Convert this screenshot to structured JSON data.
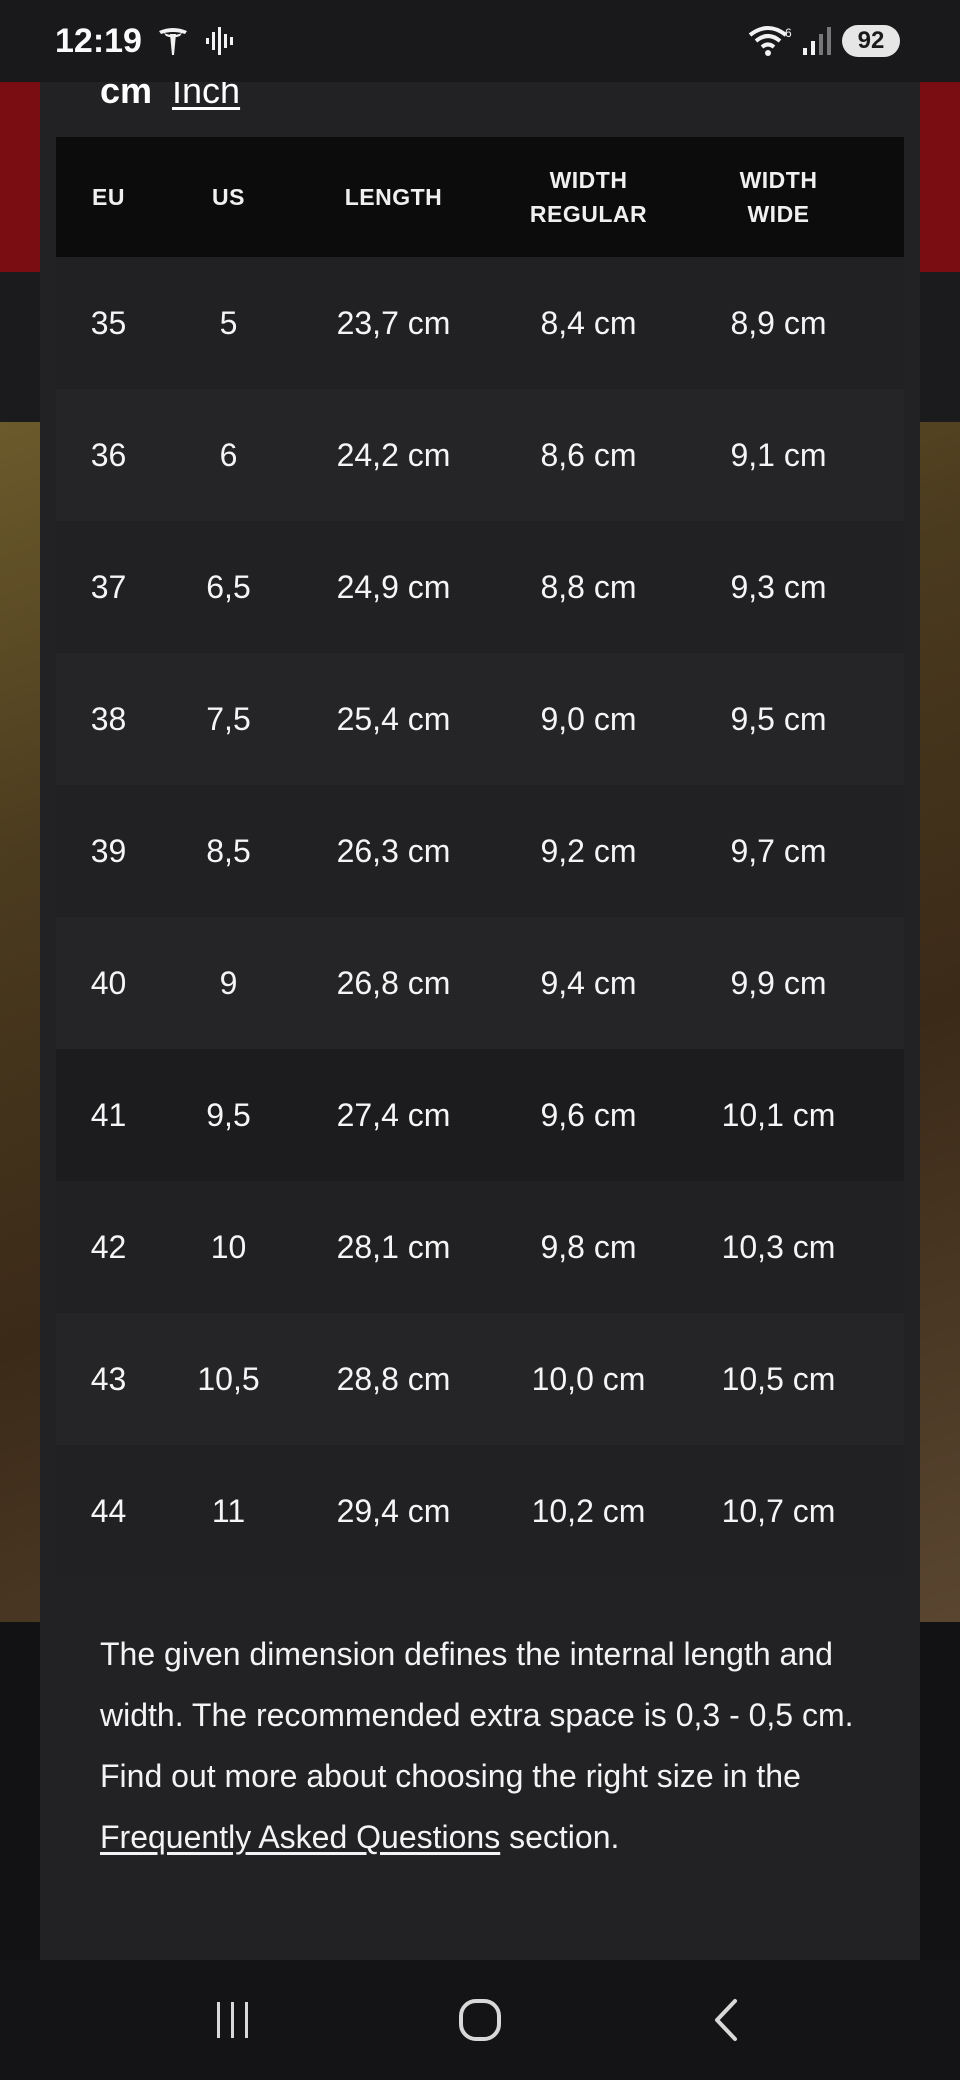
{
  "status_bar": {
    "time": "12:19",
    "battery": "92",
    "icons": [
      "tesla-icon",
      "audio-icon",
      "wifi-icon",
      "signal-icon"
    ]
  },
  "units": {
    "cm": "cm",
    "inch": "Inch"
  },
  "table": {
    "headers": {
      "eu": "EU",
      "us": "US",
      "length": "LENGTH",
      "width_regular_1": "WIDTH",
      "width_regular_2": "REGULAR",
      "width_wide_1": "WIDTH",
      "width_wide_2": "WIDE"
    },
    "rows": [
      {
        "eu": "35",
        "us": "5",
        "length": "23,7 cm",
        "width_regular": "8,4 cm",
        "width_wide": "8,9 cm"
      },
      {
        "eu": "36",
        "us": "6",
        "length": "24,2 cm",
        "width_regular": "8,6 cm",
        "width_wide": "9,1 cm"
      },
      {
        "eu": "37",
        "us": "6,5",
        "length": "24,9 cm",
        "width_regular": "8,8 cm",
        "width_wide": "9,3 cm"
      },
      {
        "eu": "38",
        "us": "7,5",
        "length": "25,4 cm",
        "width_regular": "9,0 cm",
        "width_wide": "9,5 cm"
      },
      {
        "eu": "39",
        "us": "8,5",
        "length": "26,3 cm",
        "width_regular": "9,2 cm",
        "width_wide": "9,7 cm"
      },
      {
        "eu": "40",
        "us": "9",
        "length": "26,8 cm",
        "width_regular": "9,4 cm",
        "width_wide": "9,9 cm"
      },
      {
        "eu": "41",
        "us": "9,5",
        "length": "27,4 cm",
        "width_regular": "9,6 cm",
        "width_wide": "10,1 cm"
      },
      {
        "eu": "42",
        "us": "10",
        "length": "28,1 cm",
        "width_regular": "9,8 cm",
        "width_wide": "10,3 cm"
      },
      {
        "eu": "43",
        "us": "10,5",
        "length": "28,8 cm",
        "width_regular": "10,0 cm",
        "width_wide": "10,5 cm"
      },
      {
        "eu": "44",
        "us": "11",
        "length": "29,4 cm",
        "width_regular": "10,2 cm",
        "width_wide": "10,7 cm"
      }
    ]
  },
  "note": {
    "text_before": "The given dimension defines the internal length and width. The recommended extra space is 0,3 - 0,5 cm. Find out more about choosing the right size in the ",
    "link": "Frequently Asked Questions",
    "text_after": " section."
  },
  "nav_bar": {
    "icons": [
      "recents-icon",
      "home-icon",
      "back-icon"
    ]
  },
  "colors": {
    "sheet_bg": "#222224",
    "header_bg": "#0c0c0d",
    "brand_red": "#7a0d12"
  }
}
